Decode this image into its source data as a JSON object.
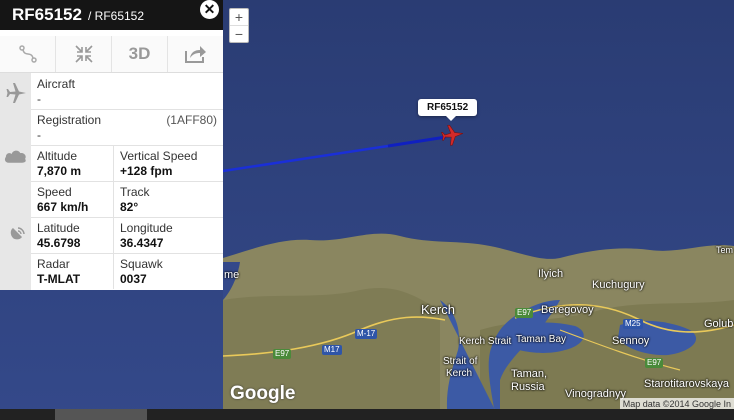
{
  "flight": {
    "callsign": "RF65152",
    "subtitle": "/ RF65152",
    "map_label": "RF65152"
  },
  "toolbar": {
    "route_icon": "route-icon",
    "collapse_icon": "collapse-icon",
    "view3d_label": "3D",
    "share_icon": "share-icon"
  },
  "details": {
    "aircraft_label": "Aircraft",
    "aircraft_value": "-",
    "registration_label": "Registration",
    "registration_value": "-",
    "registration_code": "(1AFF80)",
    "altitude_label": "Altitude",
    "altitude_value": "7,870 m",
    "vspeed_label": "Vertical Speed",
    "vspeed_value": "+128 fpm",
    "speed_label": "Speed",
    "speed_value": "667 km/h",
    "track_label": "Track",
    "track_value": "82°",
    "latitude_label": "Latitude",
    "latitude_value": "45.6798",
    "longitude_label": "Longitude",
    "longitude_value": "36.4347",
    "radar_label": "Radar",
    "radar_value": "T-MLAT",
    "squawk_label": "Squawk",
    "squawk_value": "0037"
  },
  "map": {
    "zoom_in": "+",
    "zoom_out": "−",
    "places": [
      "Kerch",
      "Ilyich",
      "Kuchugury",
      "Beregovoy",
      "Kerch Strait",
      "Taman Bay",
      "Sennoy",
      "Strait of",
      "Kerch",
      "Taman,",
      "Russia",
      "Vinogradnyy",
      "Starotitarovskaya",
      "Golub",
      "Tem",
      "me"
    ],
    "roads": [
      "M-17",
      "M17",
      "E97",
      "E97",
      "M25",
      "E97"
    ],
    "google_logo": "Google",
    "attribution": "Map data ©2014 Google In",
    "sea_color": "#2c4079",
    "route_color": "#1a2fd8",
    "aircraft_color": "#d22a2a"
  }
}
